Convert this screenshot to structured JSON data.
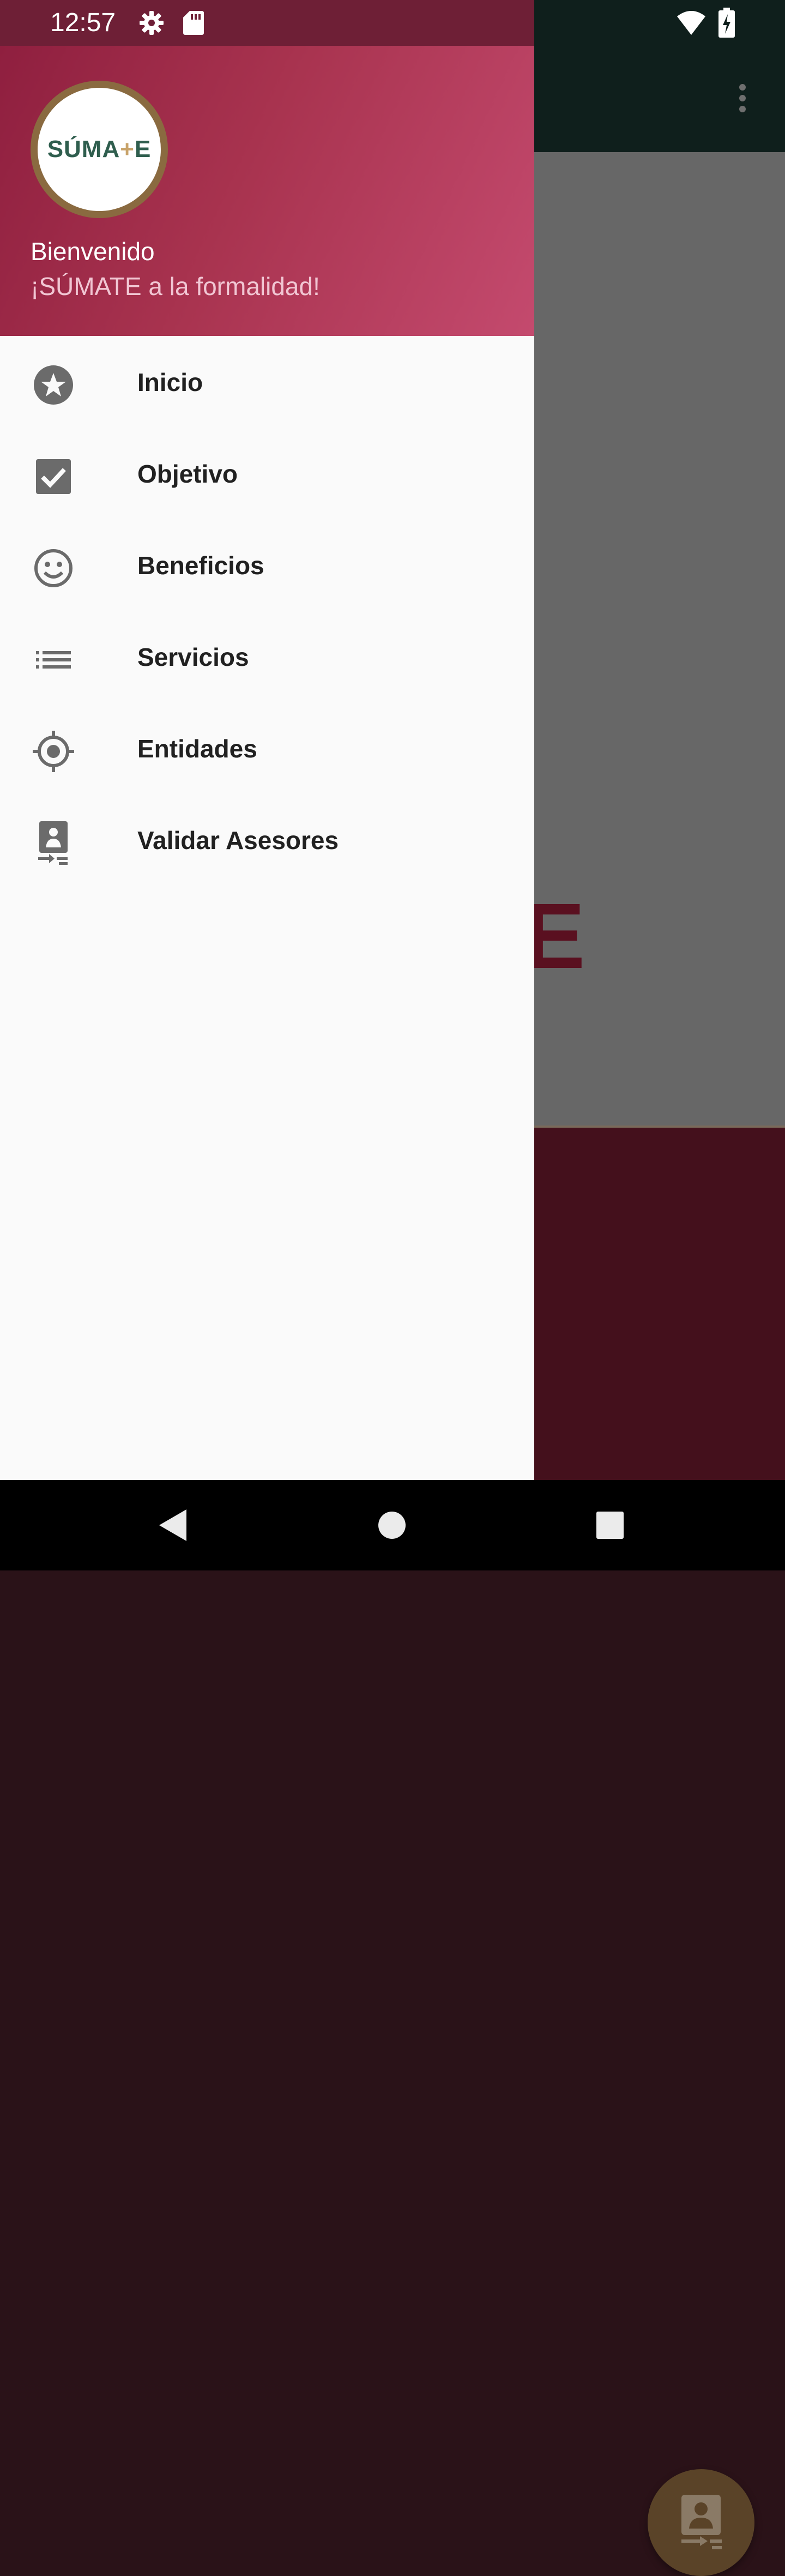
{
  "status_bar": {
    "time": "12:57",
    "icons": [
      "gear-icon",
      "sd-card-icon",
      "wifi-icon",
      "battery-charging-icon"
    ]
  },
  "drawer": {
    "logo_text_left": "SÚMA",
    "logo_text_plus": "+",
    "logo_text_right": "E",
    "welcome": "Bienvenido",
    "tagline": "¡SÚMATE a la formalidad!",
    "items": [
      {
        "label": "Inicio",
        "icon": "star-icon"
      },
      {
        "label": "Objetivo",
        "icon": "checkbox-icon"
      },
      {
        "label": "Beneficios",
        "icon": "smiley-icon"
      },
      {
        "label": "Servicios",
        "icon": "list-icon"
      },
      {
        "label": "Entidades",
        "icon": "target-icon"
      },
      {
        "label": "Validar Asesores",
        "icon": "validate-advisor-icon"
      }
    ]
  },
  "background_app": {
    "hero_fragment": "E",
    "fab_icon": "validate-advisor-icon",
    "overflow_icon": "more-vert-icon"
  },
  "colors": {
    "drawer_header_start": "#8f1f3f",
    "drawer_header_end": "#c44a6e",
    "app_bar": "#0f1f1c",
    "logo_green": "#2f5e4e",
    "logo_gold": "#c8a36a"
  },
  "nav_bar": {
    "buttons": [
      "back-icon",
      "home-icon",
      "recents-icon"
    ]
  }
}
